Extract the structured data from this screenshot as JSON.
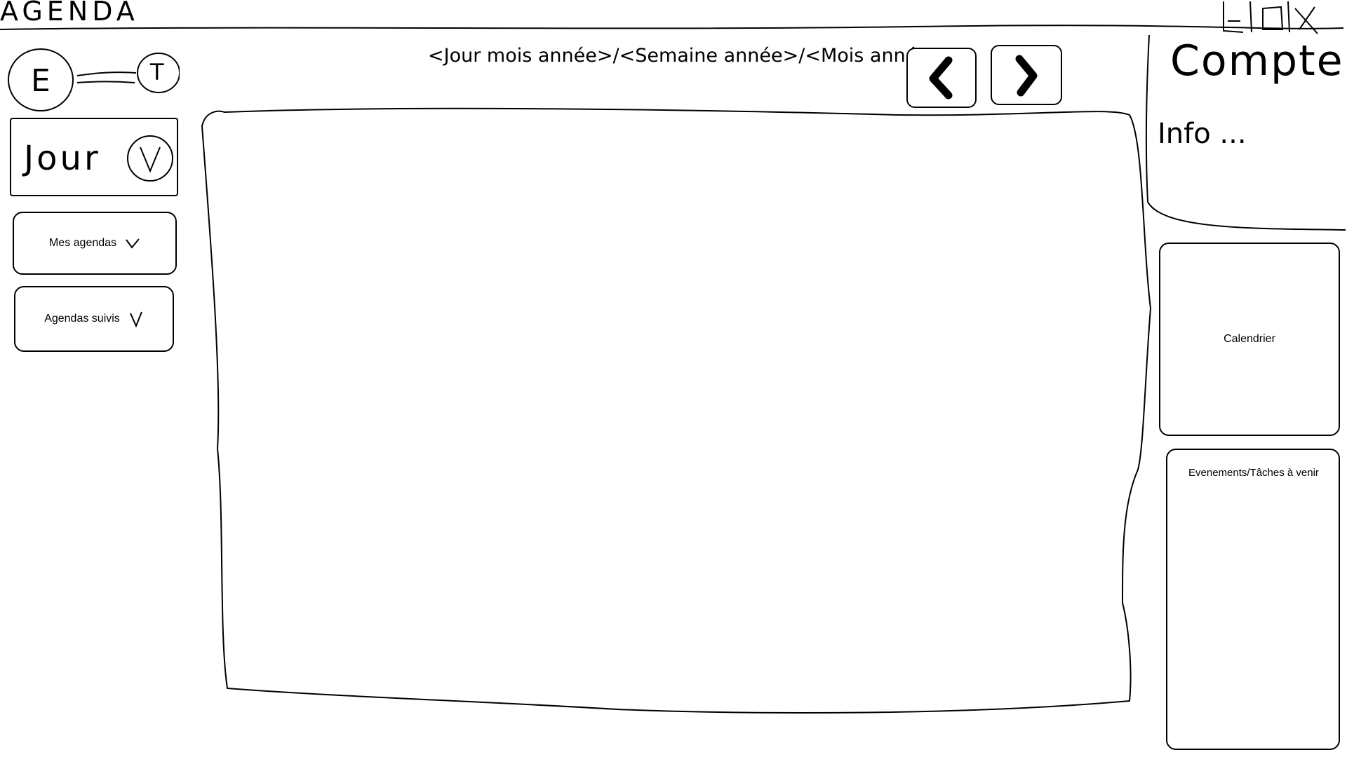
{
  "app": {
    "title": "AGENDA"
  },
  "window_controls": {
    "minimize_icon": "minimize-icon",
    "maximize_icon": "maximize-icon",
    "close_icon": "close-icon"
  },
  "toggle": {
    "left": "E",
    "right": "T"
  },
  "view_select": {
    "value": "Jour"
  },
  "sidebar": {
    "my_calendars": "Mes agendas",
    "followed_calendars": "Agendas suivis"
  },
  "header": {
    "date_label": "<Jour mois année>/<Semaine année>/<Mois année>"
  },
  "nav": {
    "prev_icon": "chevron-left-icon",
    "next_icon": "chevron-right-icon"
  },
  "account": {
    "title": "Compte",
    "info": "Info ..."
  },
  "right_panel": {
    "calendar": "Calendrier",
    "upcoming": "Evenements/Tâches à venir"
  }
}
